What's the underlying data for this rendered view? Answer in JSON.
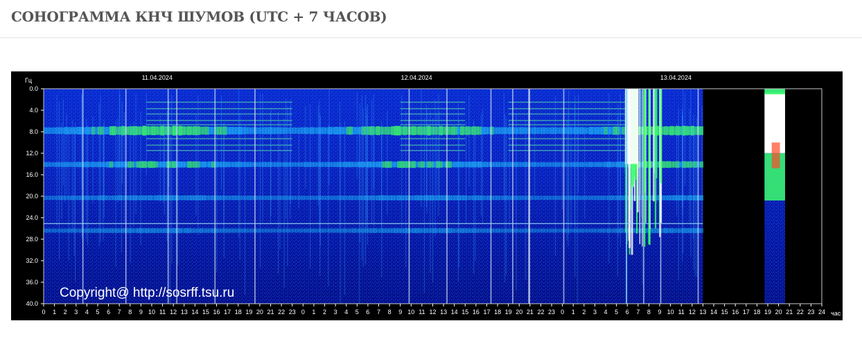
{
  "page": {
    "title": "СОНОГРАММА КНЧ ШУМОВ (UTC + 7 ЧАСОВ)"
  },
  "chart_data": {
    "type": "heatmap",
    "title": "",
    "ylabel": "Гц",
    "xlabel": "час",
    "ylim": [
      0,
      40
    ],
    "y_ticks": [
      "0.0",
      "4.0",
      "8.0",
      "12.0",
      "16.0",
      "20.0",
      "24.0",
      "28.0",
      "32.0",
      "36.0",
      "40.0"
    ],
    "x_ticks": [
      "0",
      "1",
      "2",
      "3",
      "4",
      "5",
      "6",
      "7",
      "8",
      "9",
      "10",
      "11",
      "12",
      "13",
      "14",
      "15",
      "16",
      "17",
      "18",
      "19",
      "20",
      "21",
      "22",
      "23",
      "0",
      "1",
      "2",
      "3",
      "4",
      "5",
      "6",
      "7",
      "8",
      "9",
      "10",
      "11",
      "12",
      "13",
      "14",
      "15",
      "16",
      "17",
      "18",
      "19",
      "20",
      "21",
      "22",
      "23",
      "0",
      "1",
      "2",
      "3",
      "4",
      "5",
      "6",
      "7",
      "8",
      "9",
      "10",
      "11",
      "12",
      "13",
      "14",
      "15",
      "16",
      "17",
      "18",
      "19",
      "20",
      "21",
      "22",
      "23",
      "24"
    ],
    "dates": [
      {
        "label": "11.04.2024",
        "hour_offset": 10.5
      },
      {
        "label": "12.04.2024",
        "hour_offset": 34.5
      },
      {
        "label": "13.04.2024",
        "hour_offset": 58.5
      }
    ],
    "harmonic_bands_hz": [
      {
        "hz": 7.8,
        "intensity": 0.75
      },
      {
        "hz": 14.1,
        "intensity": 0.6
      },
      {
        "hz": 20.3,
        "intensity": 0.35
      },
      {
        "hz": 26.4,
        "intensity": 0.3
      }
    ],
    "data_coverage": [
      {
        "from_hour": 0,
        "to_hour": 61
      },
      {
        "from_hour": 66.7,
        "to_hour": 68.6
      }
    ],
    "bursts": [
      {
        "from_hour": 53.8,
        "to_hour": 57.2,
        "note": "saturated"
      },
      {
        "from_hour": 66.7,
        "to_hour": 68.6,
        "note": "saturated"
      }
    ],
    "colors": {
      "background": "#000000",
      "low": "#0a1ab0",
      "mid": "#1ec8ff",
      "high": "#3cff6a",
      "peak": "#ffffff"
    },
    "copyright": "Copyright@ http://sosrff.tsu.ru"
  }
}
